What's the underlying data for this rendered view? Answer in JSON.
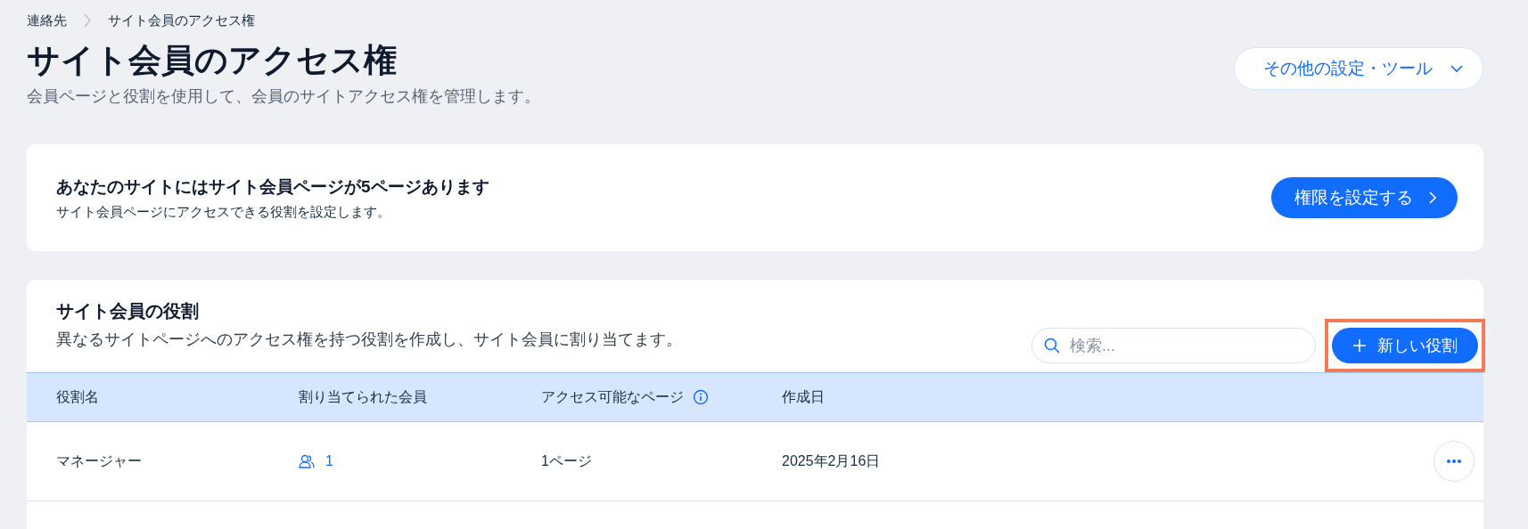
{
  "breadcrumb": [
    {
      "label": "連絡先"
    },
    {
      "label": "サイト会員のアクセス権"
    }
  ],
  "page": {
    "title": "サイト会員のアクセス権",
    "subtitle": "会員ページと役割を使用して、会員のサイトアクセス権を管理します。",
    "more_button": "その他の設定・ツール"
  },
  "pages_card": {
    "title": "あなたのサイトにはサイト会員ページが5ページあります",
    "description": "サイト会員ページにアクセスできる役割を設定します。",
    "button": "権限を設定する"
  },
  "roles_card": {
    "title": "サイト会員の役割",
    "description": "異なるサイトページへのアクセス権を持つ役割を作成し、サイト会員に割り当てます。",
    "search": {
      "placeholder": "検索..."
    },
    "new_button": {
      "label": "新しい役割",
      "highlighted": true
    },
    "table": {
      "columns": [
        {
          "label": "役割名",
          "kind": "plain"
        },
        {
          "label": "割り当てられた会員",
          "kind": "plain"
        },
        {
          "label": "アクセス可能なページ",
          "kind": "info"
        },
        {
          "label": "作成日",
          "kind": "plain"
        }
      ],
      "rows": [
        {
          "name": "マネージャー",
          "members": "1",
          "pages": "1ページ",
          "created": "2025年2月16日"
        }
      ]
    }
  }
}
